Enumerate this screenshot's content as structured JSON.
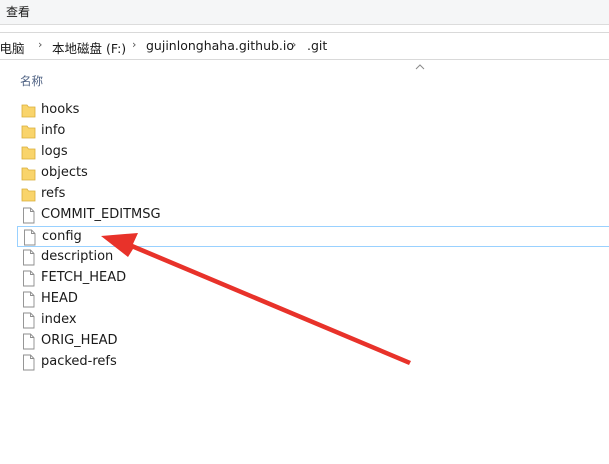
{
  "menu": {
    "view_label": "查看"
  },
  "breadcrumb": {
    "items": [
      "此电脑",
      "本地磁盘 (F:)",
      "gujinlonghaha.github.io",
      ".git"
    ]
  },
  "column": {
    "name_header": "名称"
  },
  "files": [
    {
      "name": "hooks",
      "type": "folder"
    },
    {
      "name": "info",
      "type": "folder"
    },
    {
      "name": "logs",
      "type": "folder"
    },
    {
      "name": "objects",
      "type": "folder"
    },
    {
      "name": "refs",
      "type": "folder"
    },
    {
      "name": "COMMIT_EDITMSG",
      "type": "file"
    },
    {
      "name": "config",
      "type": "file",
      "selected": true
    },
    {
      "name": "description",
      "type": "file"
    },
    {
      "name": "FETCH_HEAD",
      "type": "file"
    },
    {
      "name": "HEAD",
      "type": "file"
    },
    {
      "name": "index",
      "type": "file"
    },
    {
      "name": "ORIG_HEAD",
      "type": "file"
    },
    {
      "name": "packed-refs",
      "type": "file"
    }
  ],
  "colors": {
    "folder": "#f9d46b",
    "selection_border": "#99d1ff",
    "annotation_arrow": "#e8322a"
  }
}
